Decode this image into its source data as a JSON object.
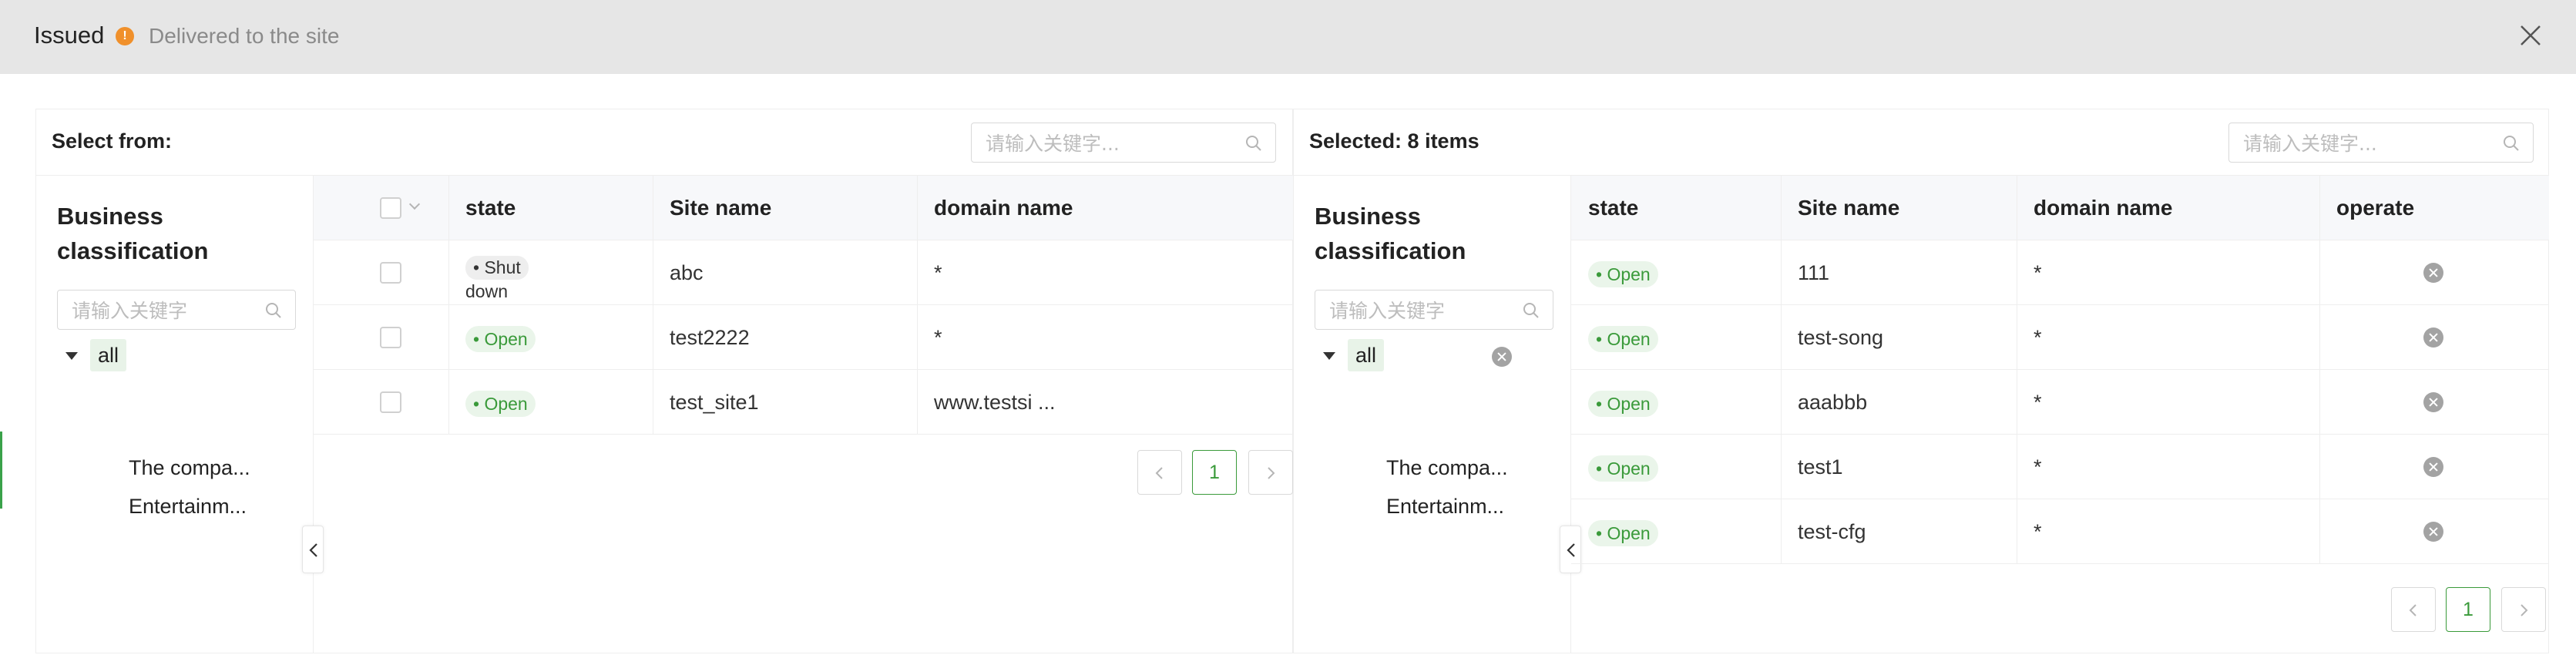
{
  "header": {
    "title": "Issued",
    "status_dot": "!",
    "subtitle": "Delivered to the site",
    "icons": {
      "status": "warning-dot-icon",
      "close": "close-icon"
    },
    "colors": {
      "status_dot": "#f0902b"
    }
  },
  "left_panel": {
    "label": "Select from:",
    "search": {
      "placeholder": "请输入关键字...",
      "value": ""
    },
    "tree": {
      "title": "Business classification",
      "search_placeholder": "请输入关键字",
      "root": "all",
      "children": [
        "The compa...",
        "Entertainm..."
      ]
    },
    "columns": [
      "state",
      "Site name",
      "domain name"
    ],
    "rows": [
      {
        "state_part1": "• Shut",
        "state_part2": "down",
        "site": "abc",
        "domain": "*"
      },
      {
        "state": "• Open",
        "site": "test2222",
        "domain": "*"
      },
      {
        "state": "• Open",
        "site": "test_site1",
        "domain": "www.testsi ..."
      }
    ],
    "pagination": {
      "current_page": "1"
    }
  },
  "right_panel": {
    "label": "Selected: 8 items",
    "search": {
      "placeholder": "请输入关键字...",
      "value": ""
    },
    "tree": {
      "title": "Business classification",
      "search_placeholder": "请输入关键字",
      "root": "all",
      "children": [
        "The compa...",
        "Entertainm..."
      ]
    },
    "columns": [
      "state",
      "Site name",
      "domain name",
      "operate"
    ],
    "rows": [
      {
        "state": "• Open",
        "site": "111",
        "domain": "*"
      },
      {
        "state": "• Open",
        "site": "test-song",
        "domain": "*"
      },
      {
        "state": "• Open",
        "site": "aaabbb",
        "domain": "*"
      },
      {
        "state": "• Open",
        "site": "test1",
        "domain": "*"
      },
      {
        "state": "• Open",
        "site": "test-cfg",
        "domain": "*"
      }
    ],
    "pagination": {
      "current_page": "1"
    }
  },
  "colors": {
    "accent": "#3a9a3a",
    "open_tag_bg": "#eaf5ea",
    "tree_selected_bg": "#e8f3e8"
  }
}
